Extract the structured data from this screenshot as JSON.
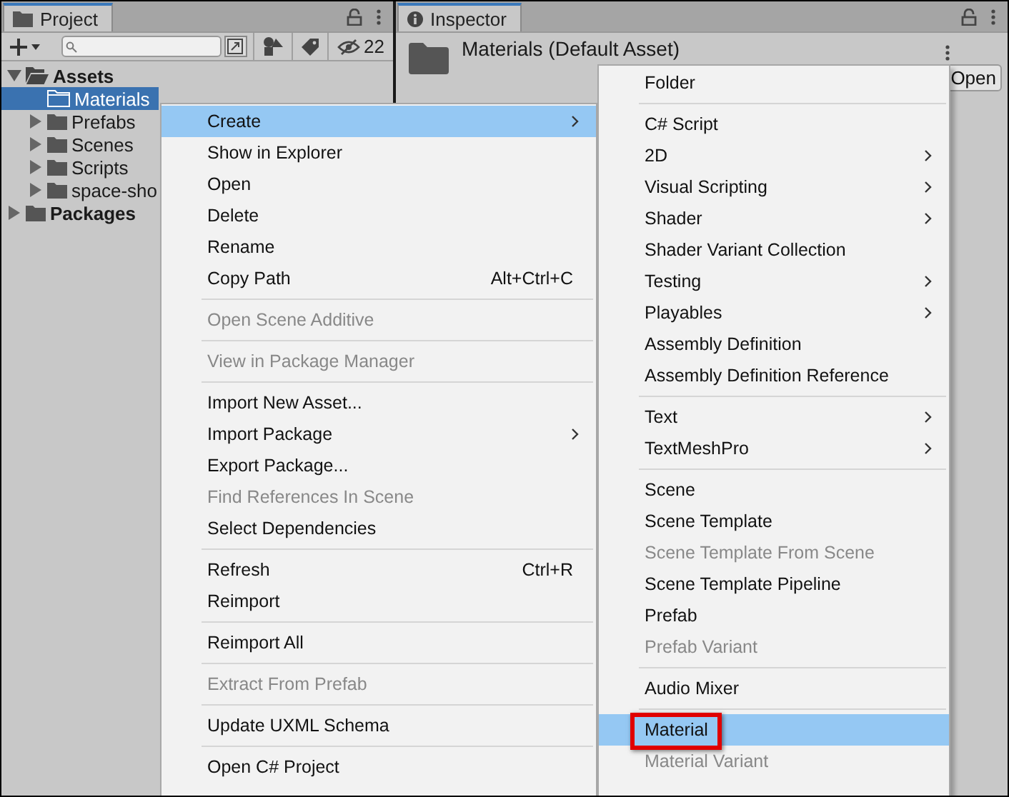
{
  "project_panel": {
    "tab": {
      "label": "Project",
      "selected": true
    },
    "hidden_count": "22",
    "tree": [
      {
        "label": "Assets",
        "expandable": true,
        "expanded": true,
        "selected": false,
        "children": [
          {
            "label": "Materials",
            "expandable": false,
            "selected": true
          },
          {
            "label": "Prefabs",
            "expandable": true,
            "expanded": false,
            "selected": false
          },
          {
            "label": "Scenes",
            "expandable": true,
            "expanded": false,
            "selected": false
          },
          {
            "label": "Scripts",
            "expandable": true,
            "expanded": false,
            "selected": false
          },
          {
            "label": "space-sho",
            "expandable": true,
            "expanded": false,
            "selected": false
          }
        ]
      },
      {
        "label": "Packages",
        "expandable": true,
        "expanded": false,
        "selected": false
      }
    ]
  },
  "inspector_panel": {
    "tab": {
      "label": "Inspector",
      "selected": true
    },
    "title": "Materials (Default Asset)",
    "open_button": "Open"
  },
  "context_menu": {
    "items": [
      {
        "kind": "item",
        "label": "Create",
        "submenu": true,
        "disabled": false,
        "selected": true,
        "annotated": false
      },
      {
        "kind": "item",
        "label": "Show in Explorer",
        "submenu": false,
        "disabled": false,
        "selected": false,
        "annotated": false
      },
      {
        "kind": "item",
        "label": "Open",
        "submenu": false,
        "disabled": false,
        "selected": false,
        "annotated": false
      },
      {
        "kind": "item",
        "label": "Delete",
        "submenu": false,
        "disabled": false,
        "selected": false,
        "annotated": false
      },
      {
        "kind": "item",
        "label": "Rename",
        "submenu": false,
        "disabled": false,
        "selected": false,
        "annotated": false
      },
      {
        "kind": "item",
        "label": "Copy Path",
        "shortcut": "Alt+Ctrl+C",
        "submenu": false,
        "disabled": false,
        "selected": false,
        "annotated": false
      },
      {
        "kind": "separator"
      },
      {
        "kind": "item",
        "label": "Open Scene Additive",
        "submenu": false,
        "disabled": true,
        "selected": false,
        "annotated": false
      },
      {
        "kind": "separator"
      },
      {
        "kind": "item",
        "label": "View in Package Manager",
        "submenu": false,
        "disabled": true,
        "selected": false,
        "annotated": false
      },
      {
        "kind": "separator"
      },
      {
        "kind": "item",
        "label": "Import New Asset...",
        "submenu": false,
        "disabled": false,
        "selected": false,
        "annotated": false
      },
      {
        "kind": "item",
        "label": "Import Package",
        "submenu": true,
        "disabled": false,
        "selected": false,
        "annotated": false
      },
      {
        "kind": "item",
        "label": "Export Package...",
        "submenu": false,
        "disabled": false,
        "selected": false,
        "annotated": false
      },
      {
        "kind": "item",
        "label": "Find References In Scene",
        "submenu": false,
        "disabled": true,
        "selected": false,
        "annotated": false
      },
      {
        "kind": "item",
        "label": "Select Dependencies",
        "submenu": false,
        "disabled": false,
        "selected": false,
        "annotated": false
      },
      {
        "kind": "separator"
      },
      {
        "kind": "item",
        "label": "Refresh",
        "shortcut": "Ctrl+R",
        "submenu": false,
        "disabled": false,
        "selected": false,
        "annotated": false
      },
      {
        "kind": "item",
        "label": "Reimport",
        "submenu": false,
        "disabled": false,
        "selected": false,
        "annotated": false
      },
      {
        "kind": "separator"
      },
      {
        "kind": "item",
        "label": "Reimport All",
        "submenu": false,
        "disabled": false,
        "selected": false,
        "annotated": false
      },
      {
        "kind": "separator"
      },
      {
        "kind": "item",
        "label": "Extract From Prefab",
        "submenu": false,
        "disabled": true,
        "selected": false,
        "annotated": false
      },
      {
        "kind": "separator"
      },
      {
        "kind": "item",
        "label": "Update UXML Schema",
        "submenu": false,
        "disabled": false,
        "selected": false,
        "annotated": false
      },
      {
        "kind": "separator"
      },
      {
        "kind": "item",
        "label": "Open C# Project",
        "submenu": false,
        "disabled": false,
        "selected": false,
        "annotated": false
      }
    ]
  },
  "create_submenu": {
    "items": [
      {
        "kind": "item",
        "label": "Folder",
        "submenu": false,
        "disabled": false,
        "selected": false,
        "annotated": false
      },
      {
        "kind": "separator"
      },
      {
        "kind": "item",
        "label": "C# Script",
        "submenu": false,
        "disabled": false,
        "selected": false,
        "annotated": false
      },
      {
        "kind": "item",
        "label": "2D",
        "submenu": true,
        "disabled": false,
        "selected": false,
        "annotated": false
      },
      {
        "kind": "item",
        "label": "Visual Scripting",
        "submenu": true,
        "disabled": false,
        "selected": false,
        "annotated": false
      },
      {
        "kind": "item",
        "label": "Shader",
        "submenu": true,
        "disabled": false,
        "selected": false,
        "annotated": false
      },
      {
        "kind": "item",
        "label": "Shader Variant Collection",
        "submenu": false,
        "disabled": false,
        "selected": false,
        "annotated": false
      },
      {
        "kind": "item",
        "label": "Testing",
        "submenu": true,
        "disabled": false,
        "selected": false,
        "annotated": false
      },
      {
        "kind": "item",
        "label": "Playables",
        "submenu": true,
        "disabled": false,
        "selected": false,
        "annotated": false
      },
      {
        "kind": "item",
        "label": "Assembly Definition",
        "submenu": false,
        "disabled": false,
        "selected": false,
        "annotated": false
      },
      {
        "kind": "item",
        "label": "Assembly Definition Reference",
        "submenu": false,
        "disabled": false,
        "selected": false,
        "annotated": false
      },
      {
        "kind": "separator"
      },
      {
        "kind": "item",
        "label": "Text",
        "submenu": true,
        "disabled": false,
        "selected": false,
        "annotated": false
      },
      {
        "kind": "item",
        "label": "TextMeshPro",
        "submenu": true,
        "disabled": false,
        "selected": false,
        "annotated": false
      },
      {
        "kind": "separator"
      },
      {
        "kind": "item",
        "label": "Scene",
        "submenu": false,
        "disabled": false,
        "selected": false,
        "annotated": false
      },
      {
        "kind": "item",
        "label": "Scene Template",
        "submenu": false,
        "disabled": false,
        "selected": false,
        "annotated": false
      },
      {
        "kind": "item",
        "label": "Scene Template From Scene",
        "submenu": false,
        "disabled": true,
        "selected": false,
        "annotated": false
      },
      {
        "kind": "item",
        "label": "Scene Template Pipeline",
        "submenu": false,
        "disabled": false,
        "selected": false,
        "annotated": false
      },
      {
        "kind": "item",
        "label": "Prefab",
        "submenu": false,
        "disabled": false,
        "selected": false,
        "annotated": false
      },
      {
        "kind": "item",
        "label": "Prefab Variant",
        "submenu": false,
        "disabled": true,
        "selected": false,
        "annotated": false
      },
      {
        "kind": "separator"
      },
      {
        "kind": "item",
        "label": "Audio Mixer",
        "submenu": false,
        "disabled": false,
        "selected": false,
        "annotated": false
      },
      {
        "kind": "separator"
      },
      {
        "kind": "item",
        "label": "Material",
        "submenu": false,
        "disabled": false,
        "selected": true,
        "annotated": true
      },
      {
        "kind": "item",
        "label": "Material Variant",
        "submenu": false,
        "disabled": true,
        "selected": false,
        "annotated": false
      }
    ]
  }
}
